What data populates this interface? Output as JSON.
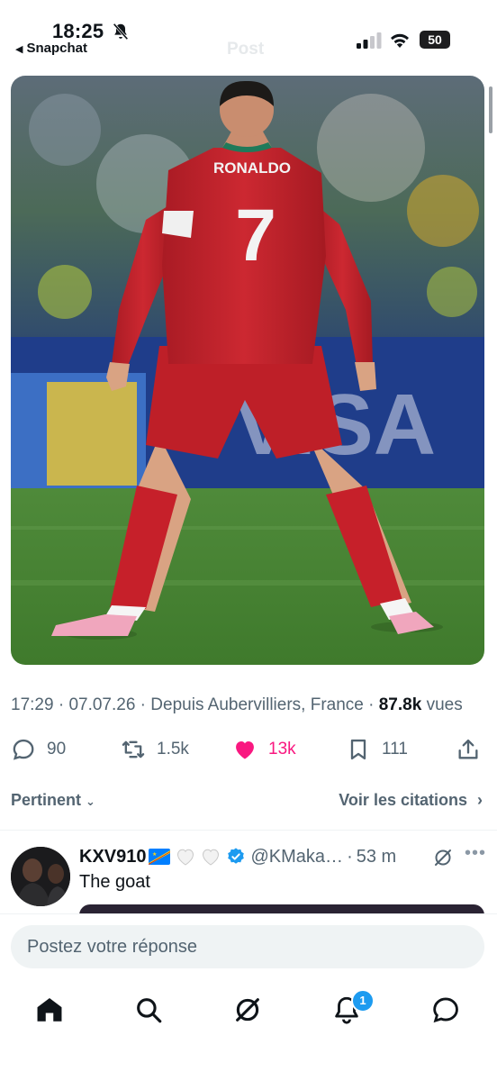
{
  "status_bar": {
    "time": "18:25",
    "back_app": "Snapchat",
    "ghost_title": "Post",
    "battery": "50"
  },
  "tweet": {
    "image_alt": "Football player in red number 7 shirt",
    "jersey_name": "RONALDO",
    "jersey_number": "7",
    "time": "17:29",
    "date": "07.07.26",
    "location": "Depuis Aubervilliers, France",
    "views": "87.8k",
    "views_label": "vues",
    "replies": "90",
    "reposts": "1.5k",
    "likes": "13k",
    "bookmarks": "111"
  },
  "sort_label": "Pertinent",
  "quotes_label": "Voir les citations",
  "reply": {
    "name": "KXV910",
    "handle": "@KMaka…",
    "age": "53 m",
    "text": "The goat"
  },
  "composer": {
    "placeholder": "Postez votre réponse"
  },
  "tabbar": {
    "notifications_badge": "1"
  },
  "colors": {
    "accent": "#1d9bf0",
    "like": "#f91880",
    "muted": "#536471",
    "shirt": "#c8232c"
  }
}
